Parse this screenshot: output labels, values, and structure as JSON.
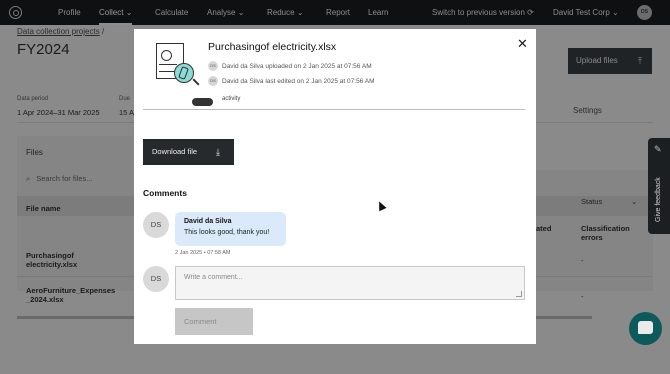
{
  "topnav": {
    "items": [
      "Profile",
      "Collect",
      "Calculate",
      "Analyse",
      "Reduce",
      "Report",
      "Learn"
    ],
    "switch_label": "Switch to previous version",
    "org_name": "David Test Corp",
    "user_initials": "DS"
  },
  "page": {
    "breadcrumb": "Data collection projects",
    "breadcrumb_separator": "/",
    "title": "FY2024",
    "data_period_label": "Data period",
    "data_period_value": "1 Apr 2024–31 Mar 2025",
    "due_label": "Due",
    "due_value": "15 A",
    "upload_label": "Upload files",
    "settings_tab": "Settings",
    "files_title": "Files",
    "search_placeholder": "Search for files...",
    "column_file_name": "File name",
    "column_ated": "ated",
    "column_classification": "Classification errors",
    "status_filter": "Status",
    "status_filter_fragment": "o",
    "files": [
      "Purchasingof electricity.xlsx",
      "AeroFurniture_Expenses _2024.xlsx"
    ],
    "row_dash": "-",
    "feedback_label": "Give feedback"
  },
  "modal": {
    "file_name": "Purchasingof electricity.xlsx",
    "events": [
      {
        "initials": "DS",
        "text": "David da Silva uploaded on 2 Jan 2025 at 07:56 AM"
      },
      {
        "initials": "DS",
        "text": "David da Silva last edited on 2 Jan 2025 at 07:56 AM"
      }
    ],
    "segment_fragment_left": "",
    "segment_fragment_right": "activity",
    "download_label": "Download file",
    "comments_heading": "Comments",
    "comment": {
      "author_initials": "DS",
      "author": "David da Silva",
      "text": "This looks good, thank you!",
      "time": "2 Jan 2025 • 07:58 AM"
    },
    "input_initials": "DS",
    "input_placeholder": "Write a comment...",
    "submit_label": "Comment"
  },
  "colors": {
    "accent_teal": "#8ddbd8",
    "chat_button": "#0c5a5c",
    "comment_bubble": "#dbeafb"
  }
}
